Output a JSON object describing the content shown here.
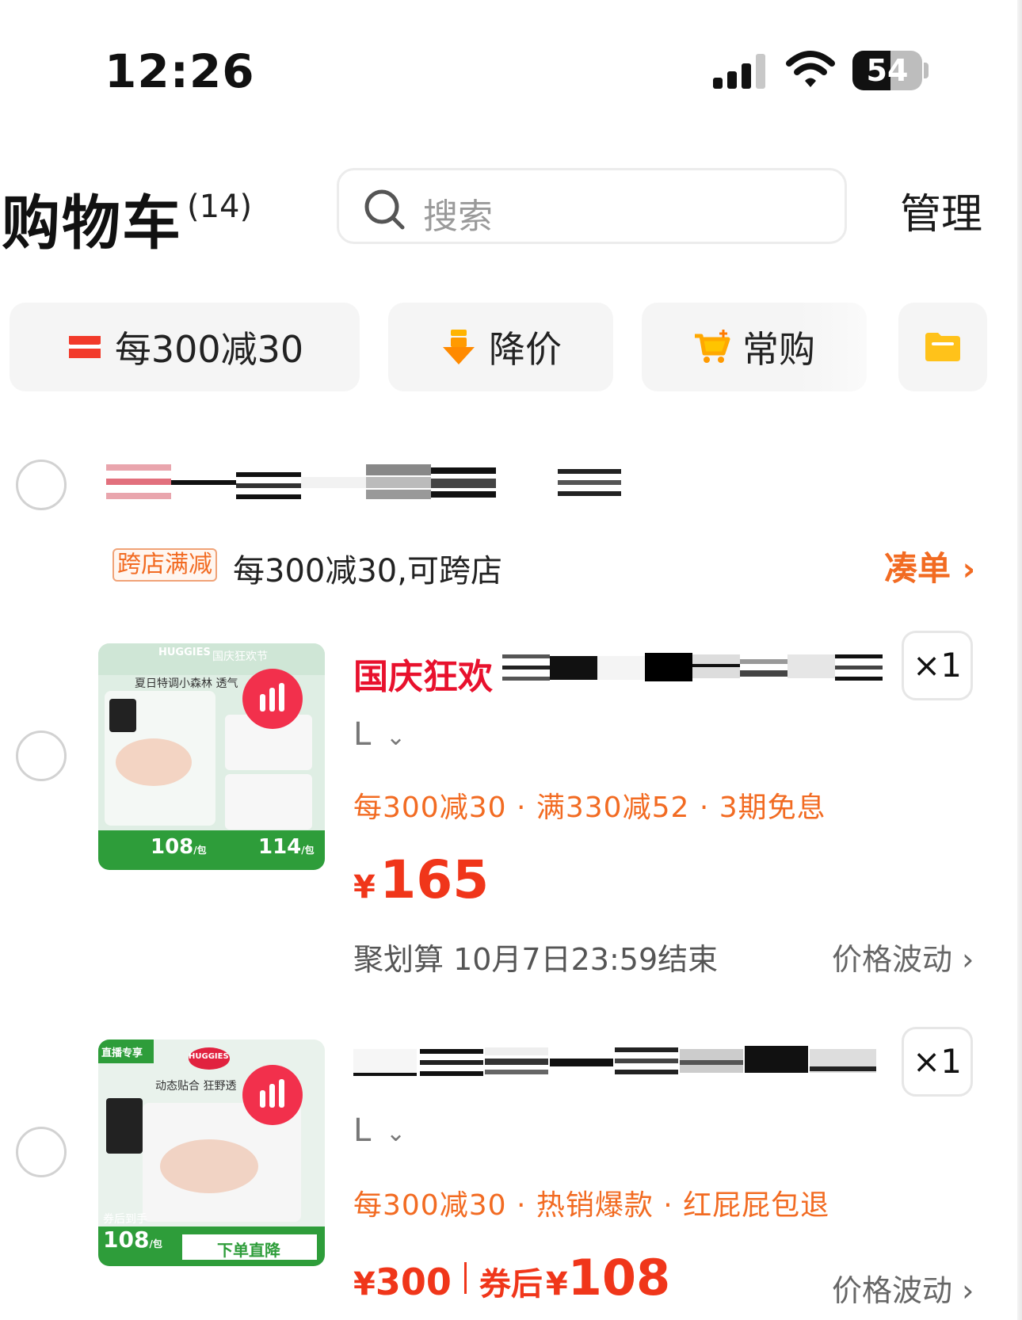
{
  "status_bar": {
    "time": "12:26",
    "battery_level": "54",
    "battery_fraction": 0.54
  },
  "header": {
    "title": "购物车",
    "count": "(14)",
    "search_placeholder": "搜索",
    "manage_label": "管理"
  },
  "filters": [
    {
      "label": "每300减30",
      "icon": "coupon-icon"
    },
    {
      "label": "降价",
      "icon": "price-drop-icon"
    },
    {
      "label": "常购",
      "icon": "cart-plus-icon"
    },
    {
      "label": "",
      "icon": "folder-icon"
    }
  ],
  "store": {
    "promo_tag": "跨店满减",
    "promo_text": "每300减30,可跨店",
    "combine_label": "凑单"
  },
  "items": [
    {
      "title_tag": "国庆狂欢",
      "sku": "L",
      "quantity": "×1",
      "benefits": "每300减30 · 满330减52 · 3期免息",
      "currency": "¥",
      "price": "165",
      "deal_info": "聚划算 10月7日23:59结束",
      "trend_label": "价格波动",
      "thumb_texts": {
        "brand": "HUGGIES",
        "event": "国庆狂欢节",
        "headline": "夏日特调小森林 透气",
        "price_left": "108",
        "price_right": "114",
        "unit": "/包"
      }
    },
    {
      "title_tag": "",
      "sku": "L",
      "quantity": "×1",
      "benefits": "每300减30 · 热销爆款 · 红屁屁包退",
      "currency": "¥",
      "price": "300",
      "after_coupon_label": "券后",
      "after_coupon_price": "108",
      "trend_label": "价格波动",
      "thumb_texts": {
        "live": "直播专享",
        "brand": "HUGGIES",
        "headline": "动态贴合 狂野透",
        "coupon": "券后到手",
        "price": "108",
        "unit": "/包",
        "cta": "下单直降"
      }
    }
  ],
  "colors": {
    "accent": "#f26b22",
    "price": "#f0361a",
    "festival": "#e8112d",
    "huggies_green": "#2e9d3a"
  }
}
